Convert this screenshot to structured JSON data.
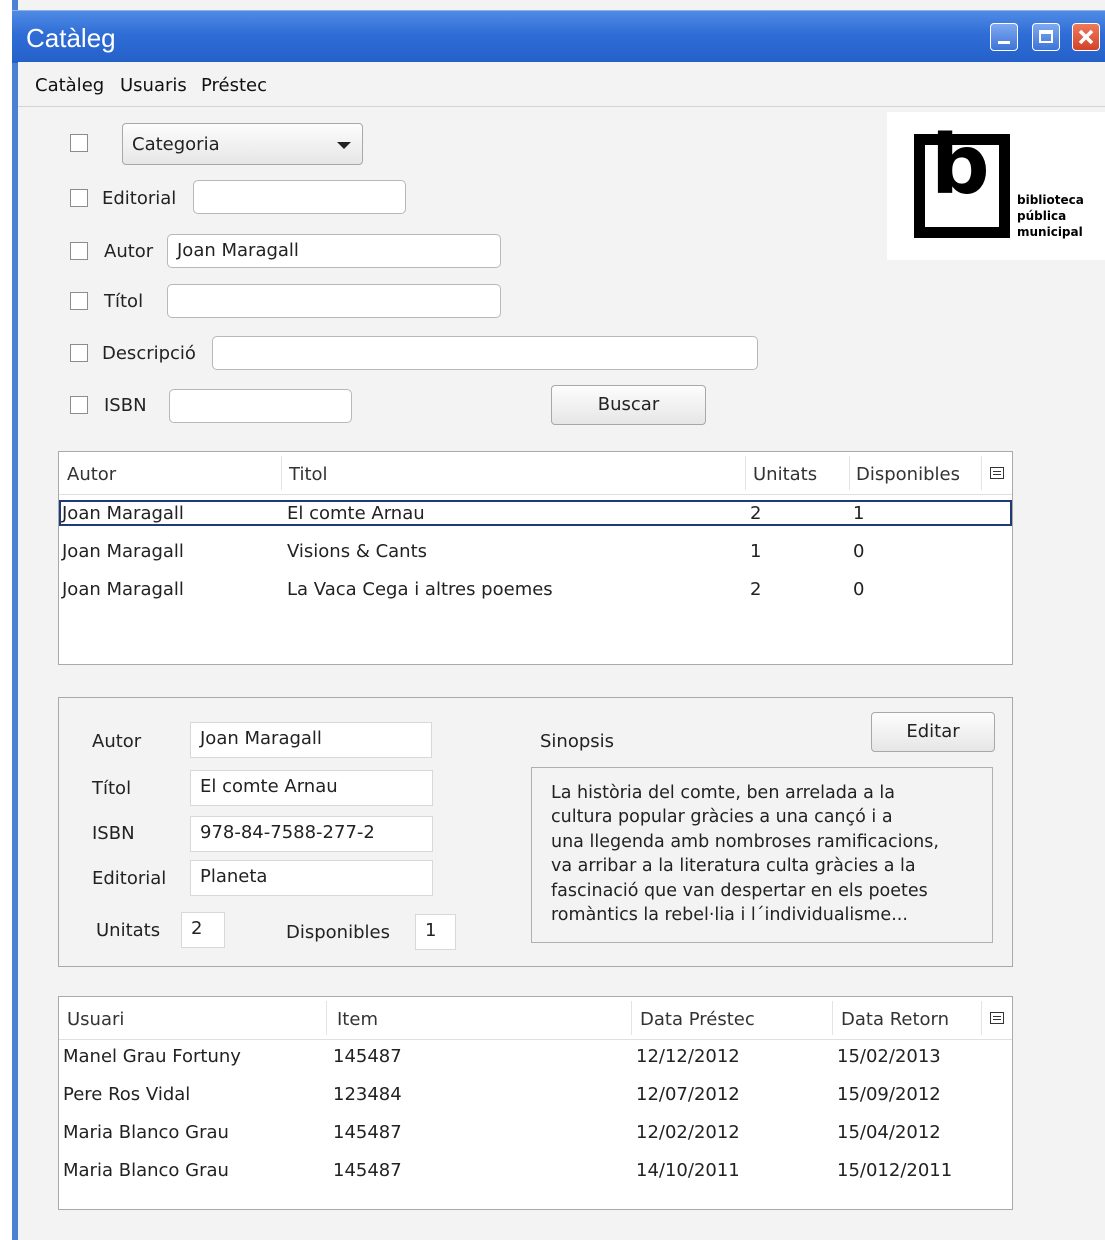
{
  "window": {
    "title": "Catàleg"
  },
  "menu": [
    "Catàleg",
    "Usuaris",
    "Préstec"
  ],
  "logo": {
    "letter": "b",
    "line1": "biblioteca",
    "line2": "pública",
    "line3": "municipal"
  },
  "filters": {
    "categoria": "Categoria",
    "editorial_label": "Editorial",
    "editorial_value": "",
    "autor_label": "Autor",
    "autor_value": "Joan Maragall",
    "titol_label": "Títol",
    "titol_value": "",
    "descripcio_label": "Descripció",
    "descripcio_value": "",
    "isbn_label": "ISBN",
    "isbn_value": "",
    "search_button": "Buscar"
  },
  "results": {
    "headers": [
      "Autor",
      "Titol",
      "Unitats",
      "Disponibles"
    ],
    "rows": [
      [
        "Joan Maragall",
        "El comte Arnau",
        "2",
        "1"
      ],
      [
        "Joan Maragall",
        "Visions & Cants",
        "1",
        "0"
      ],
      [
        "Joan Maragall",
        "La Vaca Cega i altres poemes",
        "2",
        "0"
      ]
    ]
  },
  "detail": {
    "autor_label": "Autor",
    "autor": "Joan Maragall",
    "titol_label": "Títol",
    "titol": "El comte Arnau",
    "isbn_label": "ISBN",
    "isbn": "978-84-7588-277-2",
    "editorial_label": "Editorial",
    "editorial": "Planeta",
    "unitats_label": "Unitats",
    "unitats": "2",
    "disponibles_label": "Disponibles",
    "disponibles": "1",
    "sinopsis_label": "Sinopsis",
    "edit_button": "Editar",
    "sinopsis_lines": [
      "La història del comte, ben arrelada a la",
      "cultura popular gràcies a una cançó i a",
      "una llegenda amb nombroses ramificacions,",
      "va arribar a la literatura culta gràcies a la",
      "fascinació que van despertar en els poetes",
      "romàntics la rebel·lia i l´individualisme..."
    ]
  },
  "loans": {
    "headers": [
      "Usuari",
      "Item",
      "Data Préstec",
      "Data Retorn"
    ],
    "rows": [
      [
        "Manel Grau Fortuny",
        "145487",
        "12/12/2012",
        "15/02/2013"
      ],
      [
        "Pere Ros Vidal",
        "123484",
        "12/07/2012",
        "15/09/2012"
      ],
      [
        "Maria Blanco Grau",
        "145487",
        "12/02/2012",
        "15/04/2012"
      ],
      [
        "Maria Blanco Grau",
        "145487",
        "14/10/2011",
        "15/012/2011"
      ]
    ]
  }
}
